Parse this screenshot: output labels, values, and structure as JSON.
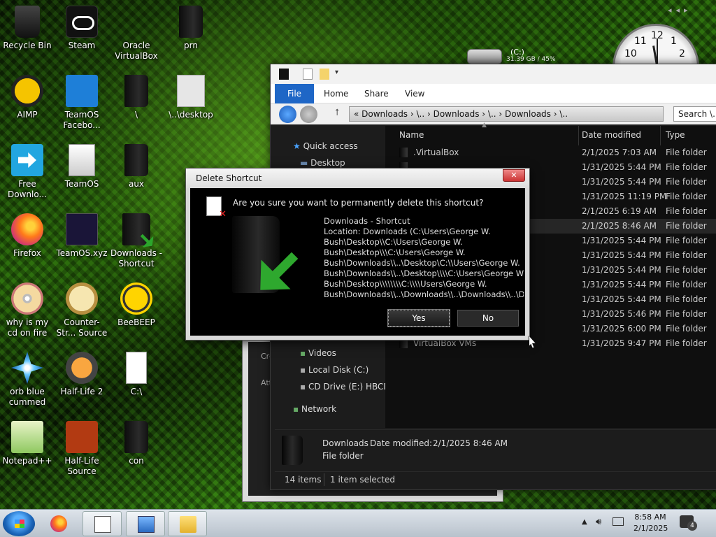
{
  "desktop_icons": [
    {
      "label": "Recycle Bin",
      "icon": "recycle-bin-icon"
    },
    {
      "label": "Steam",
      "icon": "steam-icon"
    },
    {
      "label": "Oracle VirtualBox",
      "icon": "virtualbox-icon"
    },
    {
      "label": "prn",
      "icon": "folder-icon"
    },
    {
      "label": "AIMP",
      "icon": "aimp-icon"
    },
    {
      "label": "TeamOS Facebo...",
      "icon": "settings-gear-icon"
    },
    {
      "label": "\\",
      "icon": "folder-icon"
    },
    {
      "label": "\\..\\desktop",
      "icon": "settings-file-icon"
    },
    {
      "label": "Free Downlo...",
      "icon": "free-download-icon"
    },
    {
      "label": "TeamOS",
      "icon": "teamos-file-icon"
    },
    {
      "label": "aux",
      "icon": "folder-icon"
    },
    {
      "label": "Firefox",
      "icon": "firefox-icon"
    },
    {
      "label": "TeamOS.xyz",
      "icon": "firefox-file-icon"
    },
    {
      "label": "Downloads - Shortcut",
      "icon": "downloads-folder-icon"
    },
    {
      "label": "why is my cd on fire",
      "icon": "cd-fire-icon"
    },
    {
      "label": "Counter-Str... Source",
      "icon": "counter-strike-icon"
    },
    {
      "label": "BeeBEEP",
      "icon": "bee-icon"
    },
    {
      "label": "orb blue cummed",
      "icon": "blue-orb-icon"
    },
    {
      "label": "Half-Life 2",
      "icon": "half-life-2-icon"
    },
    {
      "label": "C:\\",
      "icon": "document-icon"
    },
    {
      "label": "Notepad++",
      "icon": "notepad-plus-plus-icon"
    },
    {
      "label": "Half-Life Source",
      "icon": "half-life-source-icon"
    },
    {
      "label": "con",
      "icon": "folder-icon"
    }
  ],
  "drive_widget": {
    "label": "(C:)",
    "usage": "31.39 GB / 45%"
  },
  "clock_face": {
    "numerals": [
      "10",
      "11",
      "12",
      "1",
      "2"
    ]
  },
  "explorer": {
    "tabs": [
      "File",
      "Home",
      "Share",
      "View"
    ],
    "address": "«  Downloads  ›  \\..  ›  Downloads  ›  \\..  ›  Downloads  ›  \\..",
    "search_placeholder": "Search \\...",
    "nav": {
      "quick_access": "Quick access",
      "desktop": "Desktop",
      "videos": "Videos",
      "local_disk": "Local Disk (C:)",
      "cd_drive": "CD Drive (E:) HBCD_",
      "network": "Network"
    },
    "columns": {
      "name": "Name",
      "date": "Date modified",
      "type": "Type"
    },
    "rows": [
      {
        "name": ".VirtualBox",
        "date": "2/1/2025 7:03 AM",
        "type": "File folder"
      },
      {
        "name": "",
        "date": "1/31/2025 5:44 PM",
        "type": "File folder"
      },
      {
        "name": "",
        "date": "1/31/2025 5:44 PM",
        "type": "File folder"
      },
      {
        "name": "",
        "date": "1/31/2025 11:19 PM",
        "type": "File folder"
      },
      {
        "name": "",
        "date": "2/1/2025 6:19 AM",
        "type": "File folder"
      },
      {
        "name": "",
        "date": "2/1/2025 8:46 AM",
        "type": "File folder",
        "selected": true
      },
      {
        "name": "",
        "date": "1/31/2025 5:44 PM",
        "type": "File folder"
      },
      {
        "name": "",
        "date": "1/31/2025 5:44 PM",
        "type": "File folder"
      },
      {
        "name": "",
        "date": "1/31/2025 5:44 PM",
        "type": "File folder"
      },
      {
        "name": "",
        "date": "1/31/2025 5:44 PM",
        "type": "File folder"
      },
      {
        "name": "",
        "date": "1/31/2025 5:44 PM",
        "type": "File folder"
      },
      {
        "name": "",
        "date": "1/31/2025 5:46 PM",
        "type": "File folder"
      },
      {
        "name": "",
        "date": "1/31/2025 6:00 PM",
        "type": "File folder"
      },
      {
        "name": "VirtualBox VMs",
        "date": "1/31/2025 9:47 PM",
        "type": "File folder"
      }
    ],
    "details": {
      "name": "Downloads",
      "date_label": "Date modified:",
      "date": "2/1/2025 8:46 AM",
      "type": "File folder"
    },
    "status": {
      "items": "14 items",
      "selected": "1 item selected"
    }
  },
  "back_window": {
    "labels": [
      "Cre",
      "Att"
    ]
  },
  "dialog": {
    "title": "Delete Shortcut",
    "close": "✕",
    "question": "Are you sure you want to permanently delete this shortcut?",
    "info_name": "Downloads - Shortcut",
    "info_location": "Location: Downloads (C:\\Users\\George W.\nBush\\Desktop\\\\C:\\Users\\George W.\nBush\\Desktop\\\\\\C:\\Users\\George W.\nBush\\Downloads\\\\..\\Desktop\\C:\\\\Users\\George W.\nBush\\Downloads\\\\..\\Desktop\\\\\\\\C:\\Users\\George W.\nBush\\Desktop\\\\\\\\\\\\\\\\C:\\\\\\\\Users\\George W.\nBush\\Downloads\\\\..\\Downloads\\\\..\\Downloads\\\\..\\Dc",
    "yes": "Yes",
    "no": "No"
  },
  "taskbar": {
    "time": "8:58 AM",
    "date": "2/1/2025",
    "notifications": "4"
  }
}
